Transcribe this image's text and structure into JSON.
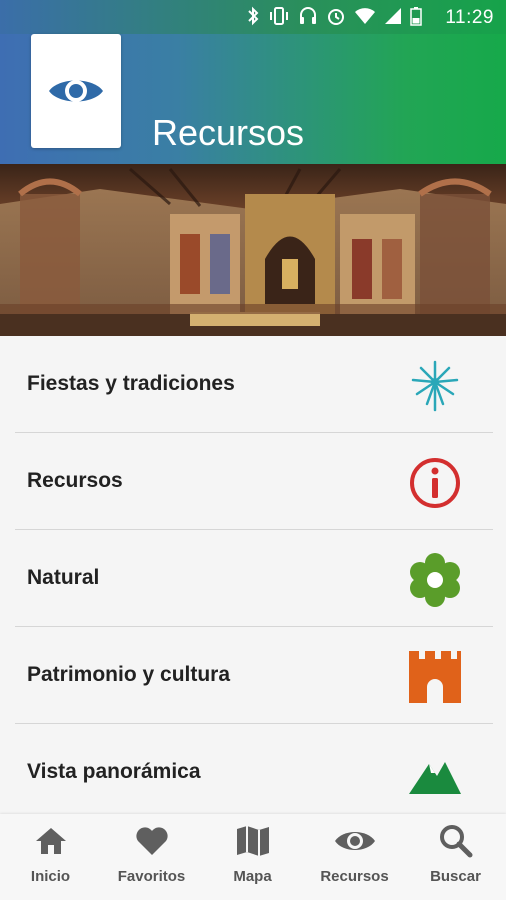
{
  "status_bar": {
    "time": "11:29"
  },
  "header": {
    "title": "Recursos",
    "logo_icon": "eye-icon"
  },
  "hero": {
    "description_icon": "church-interior-photo"
  },
  "list": {
    "items": [
      {
        "label": "Fiestas y tradiciones",
        "icon": "fireworks-icon",
        "color": "#2aa7b8"
      },
      {
        "label": "Recursos",
        "icon": "info-icon",
        "color": "#d32f2f"
      },
      {
        "label": "Natural",
        "icon": "flower-icon",
        "color": "#5a9d2a"
      },
      {
        "label": "Patrimonio y cultura",
        "icon": "castle-icon",
        "color": "#e0621a"
      },
      {
        "label": "Vista panorámica",
        "icon": "mountain-icon",
        "color": "#1a8a3e"
      }
    ]
  },
  "bottom_nav": {
    "tabs": [
      {
        "label": "Inicio",
        "icon": "home-icon"
      },
      {
        "label": "Favoritos",
        "icon": "heart-icon"
      },
      {
        "label": "Mapa",
        "icon": "map-icon"
      },
      {
        "label": "Recursos",
        "icon": "eye-icon"
      },
      {
        "label": "Buscar",
        "icon": "search-icon"
      }
    ]
  },
  "colors": {
    "header_start": "#3e6eb3",
    "header_end": "#16a94a",
    "logo_eye": "#2f6aa8",
    "nav_icon": "#5f5f5f"
  }
}
